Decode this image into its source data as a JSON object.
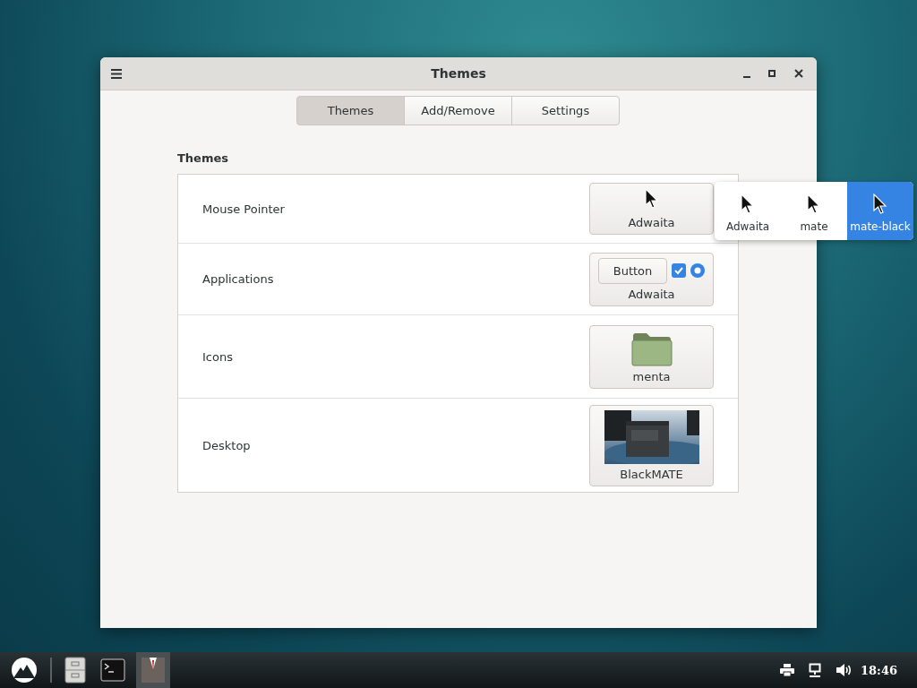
{
  "window": {
    "title": "Themes"
  },
  "tabs": [
    {
      "label": "Themes",
      "selected": true
    },
    {
      "label": "Add/Remove",
      "selected": false
    },
    {
      "label": "Settings",
      "selected": false
    }
  ],
  "section_title": "Themes",
  "rows": [
    {
      "kind": "pointer",
      "label": "Mouse Pointer",
      "value": "Adwaita"
    },
    {
      "kind": "applications",
      "label": "Applications",
      "value": "Adwaita",
      "sample_button": "Button",
      "sample_checked": true,
      "sample_radio_selected": true
    },
    {
      "kind": "icons",
      "label": "Icons",
      "value": "menta"
    },
    {
      "kind": "desktop",
      "label": "Desktop",
      "value": "BlackMATE"
    }
  ],
  "pointer_menu": [
    {
      "label": "Adwaita",
      "selected": false
    },
    {
      "label": "mate",
      "selected": false
    },
    {
      "label": "mate-black",
      "selected": true
    }
  ],
  "taskbar": {
    "clock": "18:46"
  }
}
